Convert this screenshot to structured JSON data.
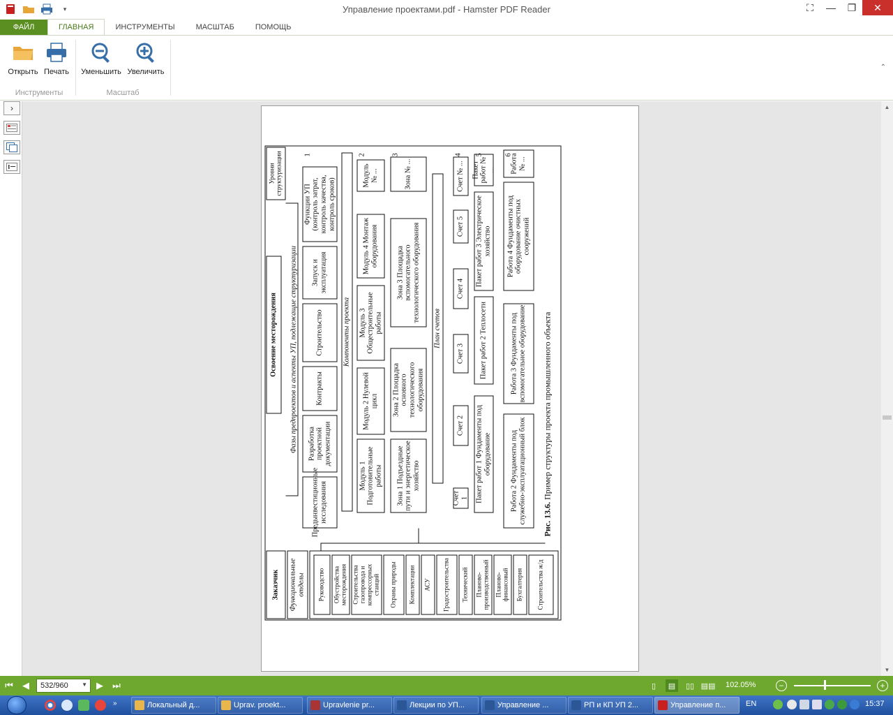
{
  "window": {
    "title": "Управление проектами.pdf - Hamster PDF Reader",
    "minimize": "—",
    "maximize": "❐",
    "close": "✕"
  },
  "ribbon": {
    "tabs": [
      "ФАЙЛ",
      "ГЛАВНАЯ",
      "ИНСТРУМЕНТЫ",
      "МАСШТАБ",
      "ПОМОЩЬ"
    ],
    "active_tab": "ГЛАВНАЯ",
    "groups": {
      "tools": {
        "label": "Инструменты",
        "buttons": {
          "open": "Открыть",
          "print": "Печать"
        }
      },
      "zoom": {
        "label": "Масштаб",
        "buttons": {
          "zoom_out": "Уменьшить",
          "zoom_in": "Увеличить"
        }
      }
    }
  },
  "document": {
    "figure": {
      "caption_bold": "Рис. 13.6.",
      "caption_text": "Пример структуры проекта промышленного объекта",
      "levels_header": "Уровни структуризации",
      "top": "Освоение месторождения",
      "phases_label": "Фазы предпроектов и аспекты УП, подлежащие структуризации",
      "phases": [
        "Предынвестиционные исследования",
        "Разработка проектной документации",
        "Контракты",
        "Строительство",
        "Запуск и эксплуатация",
        "Функции УП (контроль затрат, контроль качества, контроль сроков)"
      ],
      "components_label": "Компоненты проекта",
      "modules": [
        "Модуль 1 Подготовительные работы",
        "Модуль 2 Нулевой цикл",
        "Модуль 3 Общестроительные работы",
        "Модуль 4 Монтаж оборудования",
        "Модуль № ..."
      ],
      "zones": [
        "Зона 1 Подъездные пути и энергетическое хозяйство",
        "Зона 2 Площадка основного технологического оборудования",
        "Зона 3 Площадка вспомогательного технологического оборудования",
        "Зона № ..."
      ],
      "accounts_label": "План счетов",
      "accounts": [
        "Счет 1",
        "Счет 2",
        "Счет 3",
        "Счет 4",
        "Счет 5",
        "Счет № ..."
      ],
      "packages": [
        "Пакет работ 1 Фундаменты под оборудование",
        "Пакет работ 2 Теплосети",
        "Пакет работ 3 Электрическое хозяйство",
        "Пакет работ № ..."
      ],
      "works": [
        "Работа 2 Фундаменты под служебно-эксплуатационный блок",
        "Работа 3 Фундаменты под вспомогательное оборудование",
        "Работа 4 Фундаменты под оборудование очистных сооружений",
        "Работа № ..."
      ],
      "level_numbers": [
        "1",
        "2",
        "3",
        "4",
        "5",
        "6"
      ],
      "customer": "Заказчик",
      "departments_label": "Функциональные отделы",
      "departments": [
        "Руководство",
        "Обустройства месторождения",
        "Строительства газопровода и компрессорных станций",
        "Охраны природы",
        "Комплектации",
        "АСУ",
        "Градостроительства",
        "Технический",
        "Планово-производственный",
        "Планово-финансовый",
        "Бухгалтерия",
        "Строительства ж/д"
      ]
    }
  },
  "statusbar": {
    "page": "532/960",
    "zoom": "102.05%"
  },
  "taskbar": {
    "tasks": [
      "Локальный д...",
      "Uprav. proekt...",
      "Upravlenie pr...",
      "Лекции по УП...",
      "Управление ...",
      "РП и КП  УП 2...",
      "Управление п..."
    ],
    "lang": "EN",
    "time": "15:37"
  },
  "colors": {
    "accent": "#6ea82f",
    "file_tab": "#5b8f22",
    "close": "#c9302c",
    "taskbar": "#2a5db0"
  }
}
